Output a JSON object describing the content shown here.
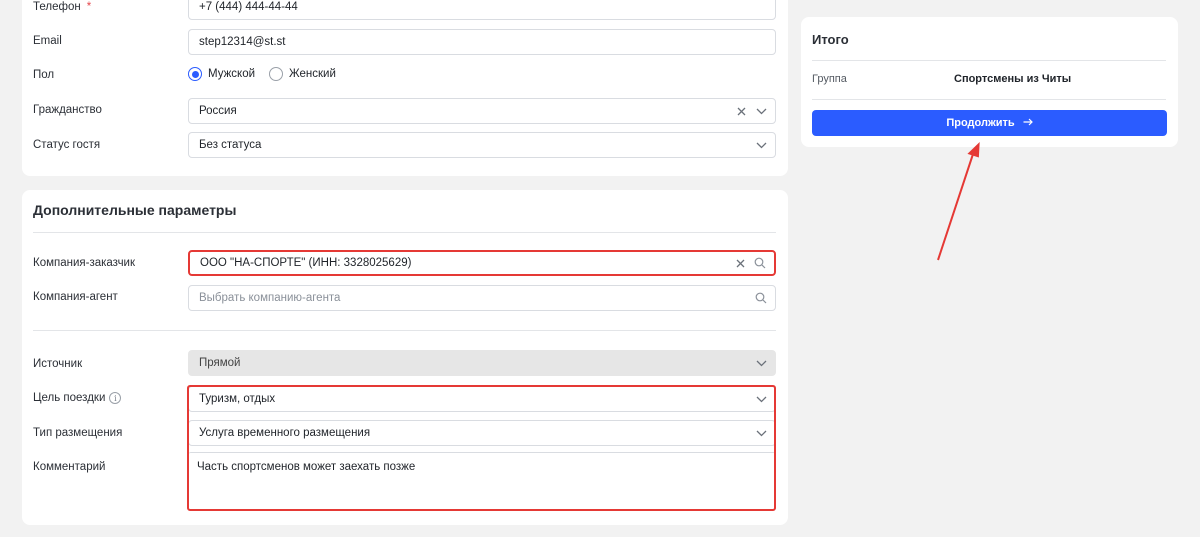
{
  "guest_form": {
    "phone": {
      "label": "Телефон",
      "required_mark": "*",
      "value": "+7 (444) 444-44-44"
    },
    "email": {
      "label": "Email",
      "value": "step12314@st.st"
    },
    "gender": {
      "label": "Пол",
      "options": [
        "Мужской",
        "Женский"
      ],
      "selected": "Мужской"
    },
    "citizenship": {
      "label": "Гражданство",
      "value": "Россия"
    },
    "guest_status": {
      "label": "Статус гостя",
      "value": "Без статуса"
    }
  },
  "extra_params": {
    "title": "Дополнительные параметры",
    "customer_company": {
      "label": "Компания-заказчик",
      "value": "ООО \"НА-СПОРТЕ\" (ИНН: 3328025629)"
    },
    "agent_company": {
      "label": "Компания-агент",
      "placeholder": "Выбрать компанию-агента"
    },
    "source": {
      "label": "Источник",
      "value": "Прямой"
    },
    "trip_purpose": {
      "label": "Цель поездки",
      "value": "Туризм, отдых",
      "info_icon": "info-circle-icon"
    },
    "accommodation_type": {
      "label": "Тип размещения",
      "value": "Услуга временного размещения"
    },
    "comment": {
      "label": "Комментарий",
      "value": "Часть спортсменов может заехать позже"
    }
  },
  "summary": {
    "title": "Итого",
    "group_label": "Группа",
    "group_value": "Спортсмены из Читы",
    "continue_button": "Продолжить",
    "continue_icon": "arrow-right-icon"
  },
  "colors": {
    "accent": "#2b5cff",
    "highlight": "#e53935",
    "background": "#f2f2f2"
  }
}
